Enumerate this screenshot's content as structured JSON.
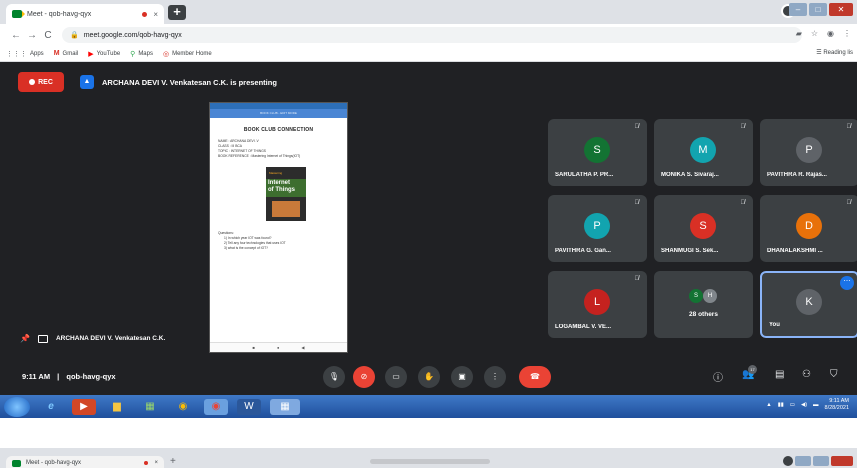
{
  "browser": {
    "tab_title": "Meet - qob-havg-qyx",
    "tab_close": "×",
    "new_tab": "+",
    "url": "meet.google.com/qob-havg-qyx",
    "nav": {
      "back": "←",
      "forward": "→",
      "reload": "C"
    },
    "bookmarks": [
      {
        "label": "Apps",
        "icon": "grid-icon"
      },
      {
        "label": "Gmail",
        "icon": "gmail-icon"
      },
      {
        "label": "YouTube",
        "icon": "youtube-icon"
      },
      {
        "label": "Maps",
        "icon": "maps-icon"
      },
      {
        "label": "Member Home",
        "icon": "member-icon"
      }
    ],
    "reading_list": "Reading lis"
  },
  "meet": {
    "rec_label": "REC",
    "presenting_banner": "ARCHANA DEVI V. Venkatesan C.K. is presenting",
    "presenter_label": "ARCHANA DEVI V. Venkatesan C.K.",
    "meeting_time": "9:11 AM",
    "separator": "|",
    "meeting_code": "qob-havg-qyx",
    "participant_badge": "17",
    "tiles": [
      {
        "name": "SARULATHA P. PR...",
        "initial": "S",
        "color": "#137333"
      },
      {
        "name": "MONIKA S. Sivaraj...",
        "initial": "M",
        "color": "#12a4af"
      },
      {
        "name": "PAVITHRA R. Rajas...",
        "initial": "P",
        "color": "#5f6368"
      },
      {
        "name": "PAVITHRA G. Gan...",
        "initial": "P",
        "color": "#12a4af"
      },
      {
        "name": "SHANMUGI S. Sek...",
        "initial": "S",
        "color": "#d93025"
      },
      {
        "name": "DHANALAKSHMI ...",
        "initial": "D",
        "color": "#e8710a"
      },
      {
        "name": "LOGAMBAL V. VE...",
        "initial": "L",
        "color": "#c5221f"
      }
    ],
    "others": {
      "label": "28 others",
      "initials": [
        "S",
        "H"
      ]
    },
    "you": {
      "name": "You",
      "initial": "K",
      "color": "#5f6368"
    }
  },
  "shared_doc": {
    "appbar": "BOOK CLUB - EDIT MODE",
    "title": "BOOK CLUB CONNECTION",
    "lines": [
      "NAME : ARCHANA DEVI .V",
      "CLASS : III BCA",
      "TOPIC : INTERNET OF THINGS",
      "BOOK REFERENCE : Mastering Internet of Things(IOT)",
      "Questions:",
      "1) In which year IOT was found?",
      "2) Tell any four technologies that uses IOT",
      "3) what is the concept of IOT?"
    ],
    "book_cover": {
      "top": "Mastering",
      "title_line1": "Internet",
      "title_line2": "of Things"
    }
  },
  "taskbar": {
    "clock_time": "9:11 AM",
    "clock_date": "8/28/2021"
  },
  "second_window": {
    "tab_title": "Meet - qob-havg-qyx",
    "tab_close": "×",
    "new_tab": "+"
  }
}
